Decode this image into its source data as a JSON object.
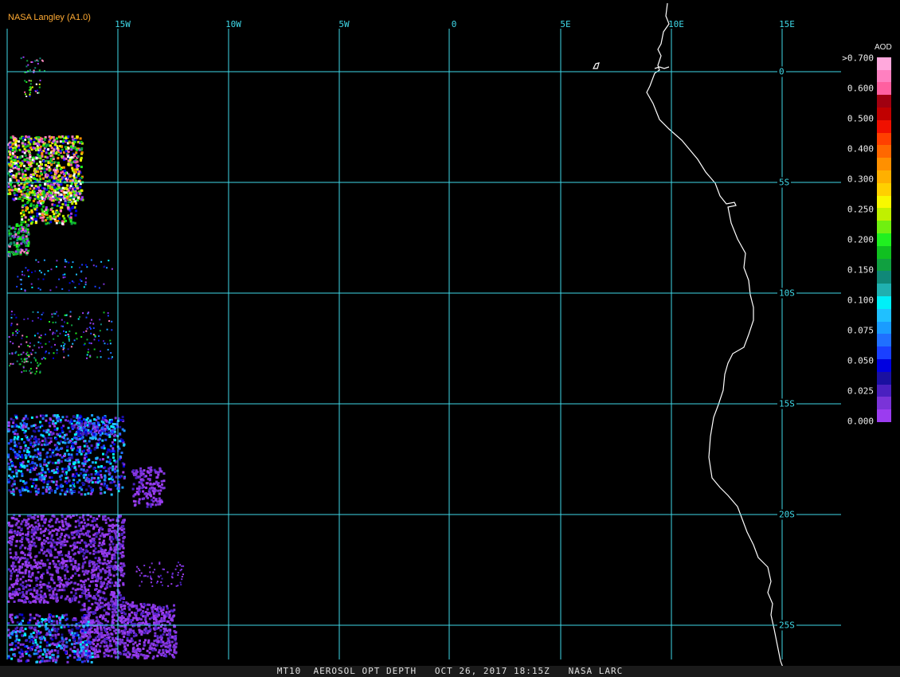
{
  "map": {
    "credit": "NASA Langley (A1.0)",
    "footer": "MT10  AEROSOL OPT DEPTH   OCT 26, 2017 18:15Z   NASA LARC",
    "grid_color": "#3fd9e8",
    "coast_color": "#ffffff",
    "longitude_labels": [
      "15W",
      "10W",
      "5W",
      "0",
      "5E",
      "10E",
      "15E"
    ],
    "latitude_labels": [
      "0",
      "5S",
      "10S",
      "15S",
      "20S",
      "25S"
    ]
  },
  "legend": {
    "title": "AOD",
    "labels": [
      ">0.700",
      "0.600",
      "0.500",
      "0.400",
      "0.300",
      "0.250",
      "0.200",
      "0.150",
      "0.100",
      "0.075",
      "0.050",
      "0.025",
      "0.000"
    ],
    "colors": [
      "#9b3cf0",
      "#7a33d8",
      "#4a20c0",
      "#1a10a0",
      "#0000e0",
      "#1a40ff",
      "#2070ff",
      "#1a9cff",
      "#20c0ff",
      "#00f0f8",
      "#20b0b0",
      "#108878",
      "#10a040",
      "#10c020",
      "#20f020",
      "#70f010",
      "#c0f000",
      "#f8f800",
      "#ffd000",
      "#ffb000",
      "#ff9000",
      "#ff6800",
      "#ff4000",
      "#f01000",
      "#c00000",
      "#a00010",
      "#ff60a0",
      "#ff80c0",
      "#ffa8dc"
    ]
  }
}
